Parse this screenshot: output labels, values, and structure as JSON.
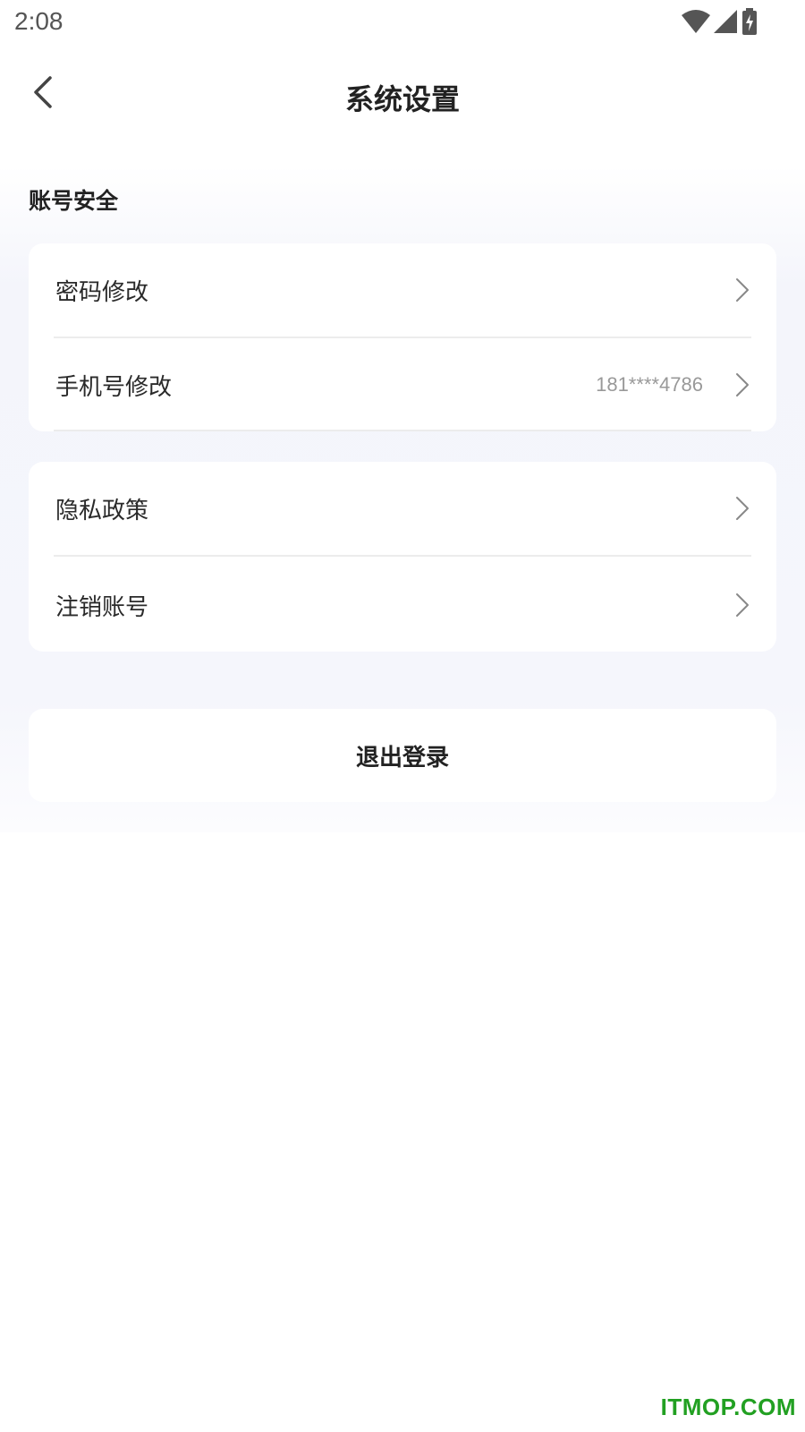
{
  "status_bar": {
    "time": "2:08",
    "icons": [
      "wifi-icon",
      "signal-icon",
      "battery-charging-icon"
    ]
  },
  "header": {
    "title": "系统设置",
    "back_icon": "chevron-left-icon"
  },
  "section": {
    "title": "账号安全"
  },
  "account_security": [
    {
      "label": "密码修改",
      "value": ""
    },
    {
      "label": "手机号修改",
      "value": "181****4786"
    }
  ],
  "other": [
    {
      "label": "隐私政策"
    },
    {
      "label": "注销账号"
    }
  ],
  "logout": {
    "label": "退出登录"
  },
  "watermark": "ITMOP.COM",
  "colors": {
    "background": "#ffffff",
    "panel": "#f5f6fc",
    "card": "#ffffff",
    "text_primary": "#222222",
    "text_secondary": "#999999",
    "watermark": "#22a022"
  }
}
